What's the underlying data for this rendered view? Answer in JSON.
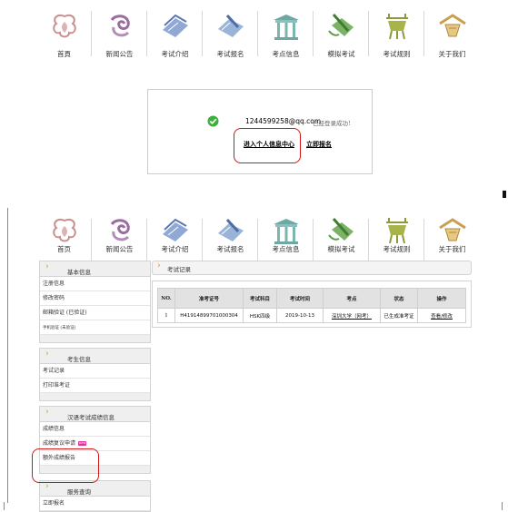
{
  "nav_top": [
    {
      "label": "首頁",
      "icon": "home-knot-icon"
    },
    {
      "label": "新闻公告",
      "icon": "news-swirl-icon"
    },
    {
      "label": "考试介绍",
      "icon": "book-icon"
    },
    {
      "label": "考试报名",
      "icon": "registration-book-icon"
    },
    {
      "label": "考点信息",
      "icon": "pavilion-icon"
    },
    {
      "label": "模拟考试",
      "icon": "brush-icon"
    },
    {
      "label": "考试规则",
      "icon": "ding-vessel-icon"
    },
    {
      "label": "关于我们",
      "icon": "roof-lantern-icon"
    }
  ],
  "nav_bottom": [
    {
      "label": "首页"
    },
    {
      "label": "新闻公告"
    },
    {
      "label": "考试介绍"
    },
    {
      "label": "考试报名"
    },
    {
      "label": "考点信息"
    },
    {
      "label": "模拟考试"
    },
    {
      "label": "考试规则"
    },
    {
      "label": "关于我们"
    }
  ],
  "login": {
    "email": "1244599258@qq.com",
    "message": "已经登录成功!",
    "enter_center": "进入个人信息中心",
    "register_now": "立即报名"
  },
  "sidebar": [
    {
      "title": "基本信息",
      "rows": [
        "注册信息",
        "修改密码",
        "邮箱验证 (已验证)",
        "手机验证 (未验证)"
      ]
    },
    {
      "title": "考生信息",
      "rows": [
        "考试记录",
        "打印准考证"
      ]
    },
    {
      "title": "汉语考试成绩信息",
      "rows": [
        "成绩信息",
        "成绩复议申请",
        "额外成绩报告"
      ]
    },
    {
      "title": "服务查询",
      "rows": [
        "立即报名"
      ]
    }
  ],
  "badge_new": "new",
  "records": {
    "title": "考试记录",
    "headers": [
      "NO.",
      "准考证号",
      "考试科目",
      "考试时间",
      "考点",
      "状态",
      "操作"
    ],
    "rows": [
      [
        "1",
        "H41914899701000304",
        "HSK四级",
        "2019-10-13",
        "深圳大学（网考）",
        "已生成准考证",
        "查看/修改"
      ]
    ]
  }
}
